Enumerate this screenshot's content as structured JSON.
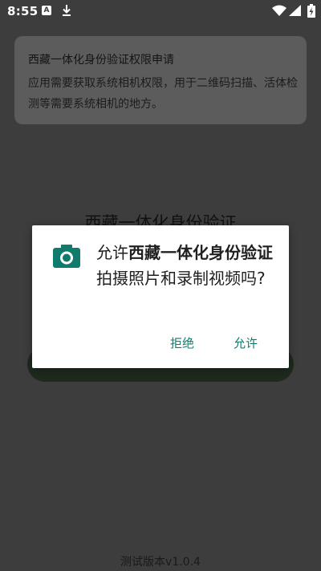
{
  "status_bar": {
    "time": "8:55",
    "app_icon_letter": "A",
    "icons": [
      "a-notification-icon",
      "download-icon",
      "wifi-icon",
      "signal-icon",
      "battery-charging-icon"
    ]
  },
  "info_card": {
    "title": "西藏一体化身份验证权限申请",
    "description": "应用需要获取系统相机权限，用于二维码扫描、活体检测等需要系统相机的地方。"
  },
  "background": {
    "app_title": "西藏一体化身份验证",
    "version": "测试版本v1.0.4"
  },
  "dialog": {
    "icon": "camera-icon",
    "prefix": "允许",
    "app_name": "西藏一体化身份验证",
    "suffix": "拍摄照片和录制视频吗?",
    "deny_label": "拒绝",
    "allow_label": "允许"
  },
  "colors": {
    "accent": "#0f7b6c",
    "scrim": "#3d3d3d",
    "card": "#5c5c5c"
  }
}
